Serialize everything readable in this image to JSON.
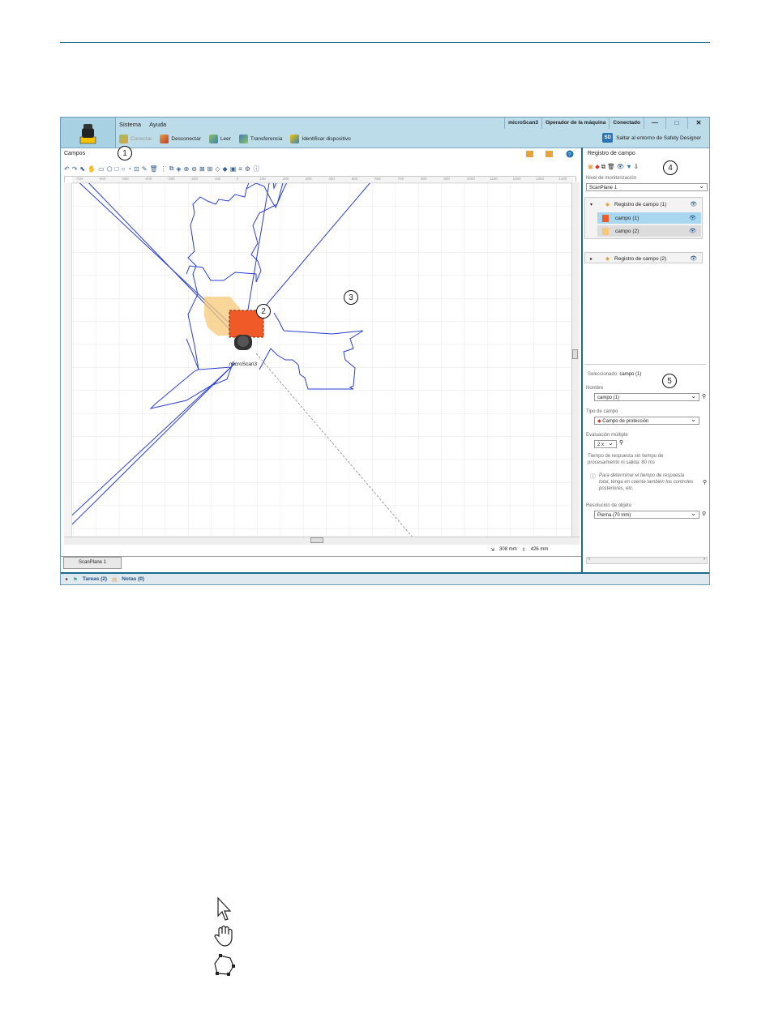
{
  "callouts": [
    "1",
    "2",
    "3",
    "4",
    "5"
  ],
  "app": {
    "menu": [
      "Sistema",
      "Ayuda"
    ],
    "title_status": [
      "microScan3",
      "Operador de la máquina",
      "Conectado"
    ],
    "window_buttons": [
      "—",
      "□",
      "✕"
    ],
    "toolbar": [
      {
        "label": "Conectar",
        "icon": "connect-icon",
        "disabled": true
      },
      {
        "label": "Desconectar",
        "icon": "disconnect-icon"
      },
      {
        "label": "Leer",
        "icon": "read-icon"
      },
      {
        "label": "Transferencia",
        "icon": "transfer-icon"
      },
      {
        "label": "Identificar dispositivo",
        "icon": "identify-device-icon"
      }
    ],
    "safety_designer": {
      "badge": "SD",
      "label": "Saltar al entorno de Safety Designer"
    }
  },
  "left_panel": {
    "title": "Campos",
    "ruler_ticks": [
      "-700",
      "-600",
      "-500",
      "-400",
      "-300",
      "-200",
      "-100",
      "0",
      "100",
      "200",
      "300",
      "400",
      "500",
      "600",
      "700",
      "800",
      "900",
      "1000",
      "1100",
      "1200",
      "1300",
      "1400"
    ],
    "device_label": "microScan3",
    "status": {
      "x": "308 mm",
      "y": "426 mm"
    },
    "tab": "ScanPlane 1"
  },
  "right_panel": {
    "title": "Registro de campo",
    "monitoring_label": "Nivel de monitorización",
    "monitoring_value": "ScanPlane 1",
    "tree": {
      "group1": "Registro de campo (1)",
      "item1": "campo (1)",
      "item2": "campo (2)",
      "group2": "Registro de campo (2)"
    },
    "selected_prefix": "Seleccionado:",
    "selected_value": "campo (1)",
    "name_label": "Nombre",
    "name_value": "campo (1)",
    "type_label": "Tipo de campo",
    "type_value": "Campo de protección",
    "eval_label": "Evaluación múltiple",
    "eval_value": "2 x",
    "response_time": "Tiempo de respuesta sin tiempo de procesamiento ni salida: 80 ms",
    "info_note": "Para determinar el tiempo de respuesta total, tenga en cuenta también los controles posteriores, etc.",
    "resolution_label": "Resolución de objeto",
    "resolution_value": "Pierna (70 mm)"
  },
  "tasks": {
    "tasks": "Tareas (2)",
    "notes": "Notas (0)"
  },
  "colors": {
    "accent": "#1b6c8e",
    "header": "#bcdcea",
    "field1": "#f05a28",
    "field2": "#f7c878",
    "contour": "#2b3fcf"
  },
  "bottom_icons": [
    "arrow-cursor-icon",
    "hand-cursor-icon",
    "polygon-edit-cursor-icon"
  ]
}
